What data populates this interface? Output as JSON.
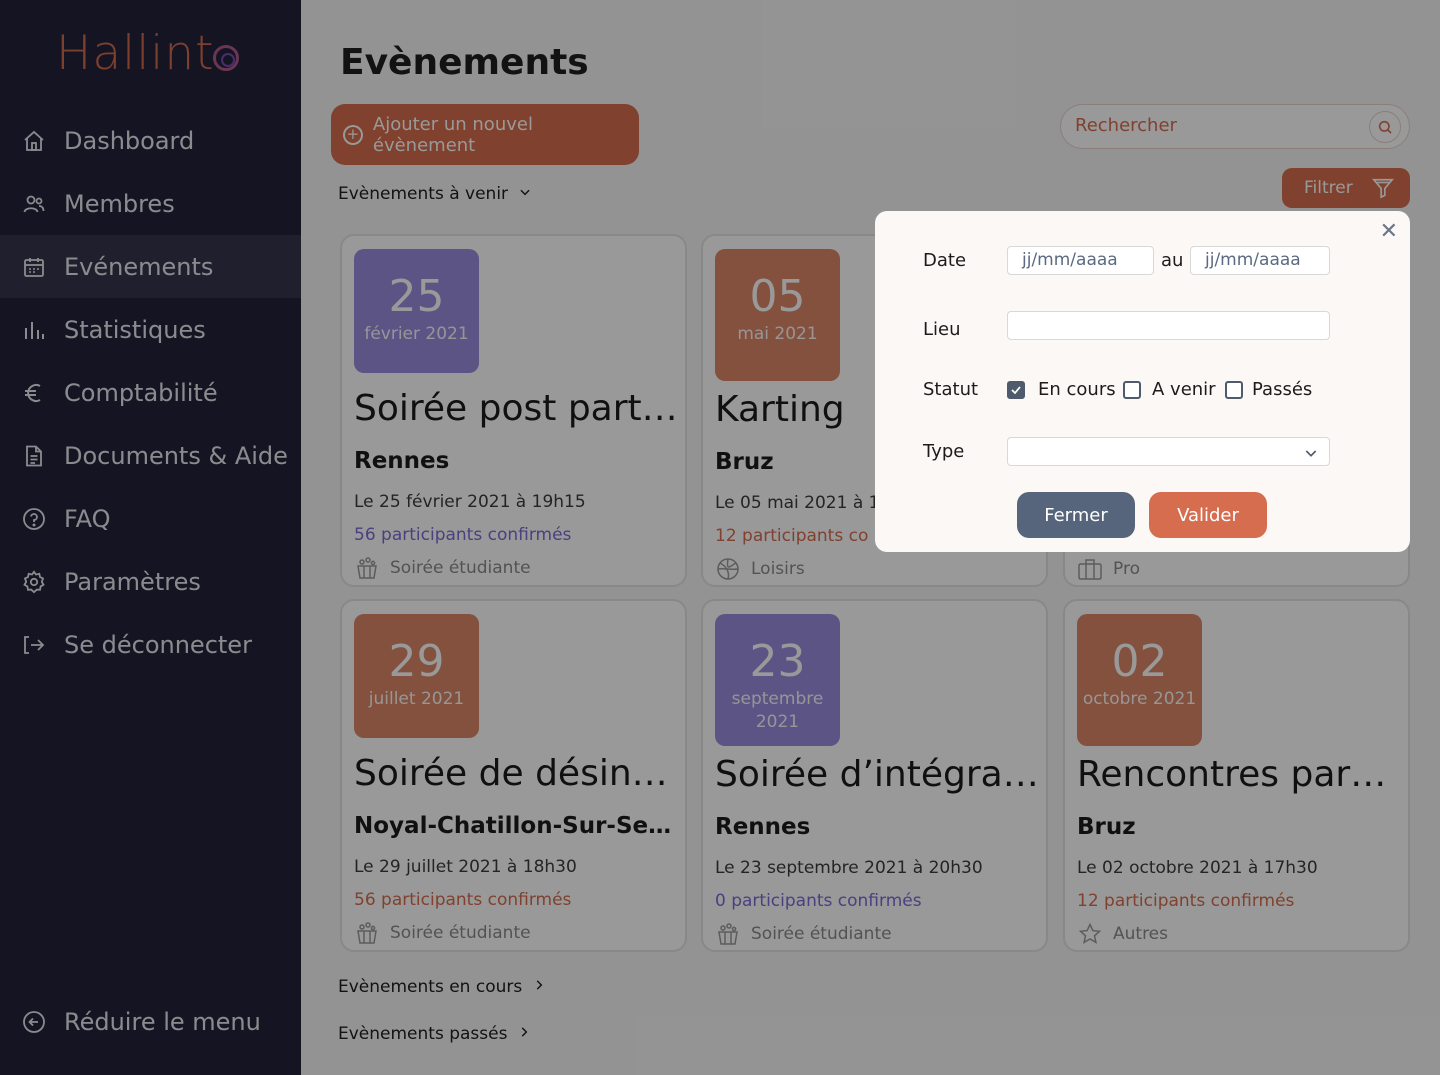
{
  "app": {
    "logo": "Hallint"
  },
  "sidebar": {
    "items": [
      {
        "label": "Dashboard",
        "icon": "home-icon"
      },
      {
        "label": "Membres",
        "icon": "users-icon"
      },
      {
        "label": "Evénements",
        "icon": "calendar-icon",
        "active": true
      },
      {
        "label": "Statistiques",
        "icon": "bar-chart-icon"
      },
      {
        "label": "Comptabilité",
        "icon": "euro-icon"
      },
      {
        "label": "Documents & Aide",
        "icon": "document-icon"
      },
      {
        "label": "FAQ",
        "icon": "help-circle-icon"
      },
      {
        "label": "Paramètres",
        "icon": "gear-icon"
      },
      {
        "label": "Se déconnecter",
        "icon": "logout-icon"
      }
    ],
    "collapse_label": "Réduire le menu"
  },
  "main": {
    "title": "Evènements",
    "add_button": "Ajouter un nouvel évènement",
    "search_placeholder": "Rechercher",
    "filter_button": "Filtrer",
    "section_upcoming": "Evènements à venir",
    "section_current": "Evènements en cours",
    "section_past": "Evènements passés"
  },
  "events": [
    {
      "day": "25",
      "month": "février 2021",
      "title": "Soirée post partiels",
      "city": "Rennes",
      "when": "Le 25 février 2021 à 19h15",
      "participants": "56 participants confirmés",
      "type": "Soirée étudiante",
      "color": "purple"
    },
    {
      "day": "05",
      "month": "mai 2021",
      "title": "Karting",
      "city": "Bruz",
      "when": "Le 05 mai 2021 à 1",
      "participants": "12 participants co",
      "type": "Loisirs",
      "color": "coral"
    },
    {
      "type": "Pro"
    },
    {
      "day": "29",
      "month": "juillet 2021",
      "title": "Soirée de désinté ...",
      "city": "Noyal-Chatillon-Sur-Sei ...",
      "when": "Le 29 juillet 2021 à 18h30",
      "participants": "56 participants confirmés",
      "type": "Soirée étudiante",
      "color": "coral"
    },
    {
      "day": "23",
      "month": "septembre 2021",
      "title": "Soirée d’intégration",
      "city": "Rennes",
      "when": "Le 23 septembre 2021 à 20h30",
      "participants": "0 participants confirmés",
      "type": "Soirée étudiante",
      "color": "purple"
    },
    {
      "day": "02",
      "month": "octobre 2021",
      "title": "Rencontres parai ...",
      "city": "Bruz",
      "when": "Le 02 octobre 2021 à 17h30",
      "participants": "12 participants confirmés",
      "type": "Autres",
      "color": "coral"
    }
  ],
  "filter_modal": {
    "date_label": "Date",
    "date_from_placeholder": "jj/mm/aaaa",
    "date_sep": "au",
    "date_to_placeholder": "jj/mm/aaaa",
    "place_label": "Lieu",
    "status_label": "Statut",
    "status_options": [
      {
        "label": "En cours",
        "checked": true
      },
      {
        "label": "A venir",
        "checked": false
      },
      {
        "label": "Passés",
        "checked": false
      }
    ],
    "type_label": "Type",
    "type_value": "",
    "close_button": "Fermer",
    "submit_button": "Valider"
  },
  "colors": {
    "sidebar_bg": "#23223a",
    "accent": "#d56d4e",
    "purple": "#9c8de0",
    "slate": "#56657b"
  }
}
